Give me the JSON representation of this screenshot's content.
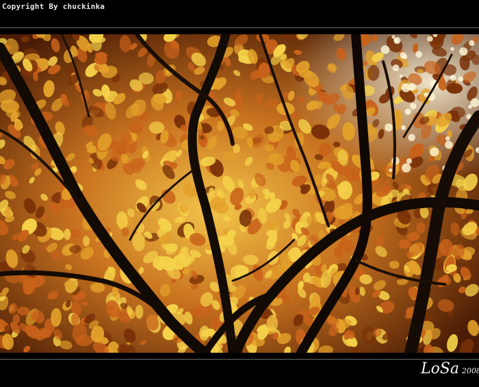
{
  "watermark": {
    "copyright": "Copyright By chuckinka"
  },
  "signature": {
    "name": "LoSa",
    "year": "2008"
  },
  "photo": {
    "subject": "autumn beech canopy",
    "colors": {
      "leaf_bright": "#f5d24a",
      "leaf_gold": "#e3a12a",
      "leaf_orange": "#c8621a",
      "leaf_dark": "#7a3208",
      "branch": "#120a05",
      "sky": "#fff7d8"
    }
  }
}
